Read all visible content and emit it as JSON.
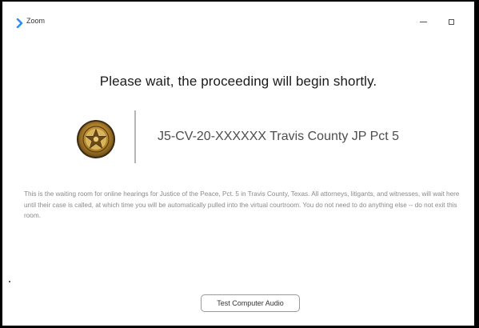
{
  "window": {
    "title": "Zoom",
    "logo_icon": "zoom-logo-icon",
    "controls": {
      "minimize_icon": "minimize-icon",
      "maximize_icon": "maximize-icon"
    }
  },
  "waiting_room": {
    "headline": "Please wait, the proceeding will begin shortly.",
    "seal_icon": "county-seal-icon",
    "case_title": "J5-CV-20-XXXXXX Travis County JP Pct 5",
    "description": "This is the waiting room for online hearings for Justice of the Peace, Pct. 5 in Travis County, Texas. All attorneys, litigants, and witnesses, will wait here until their case is called, at which time you will be automatically pulled into the virtual courtroom. You do not need to do anything else -- do not exit this room.",
    "test_audio_label": "Test Computer Audio"
  },
  "colors": {
    "zoom_blue": "#2d8cff",
    "seal_gold": "#b8892e",
    "seal_dark": "#3a2a14"
  }
}
